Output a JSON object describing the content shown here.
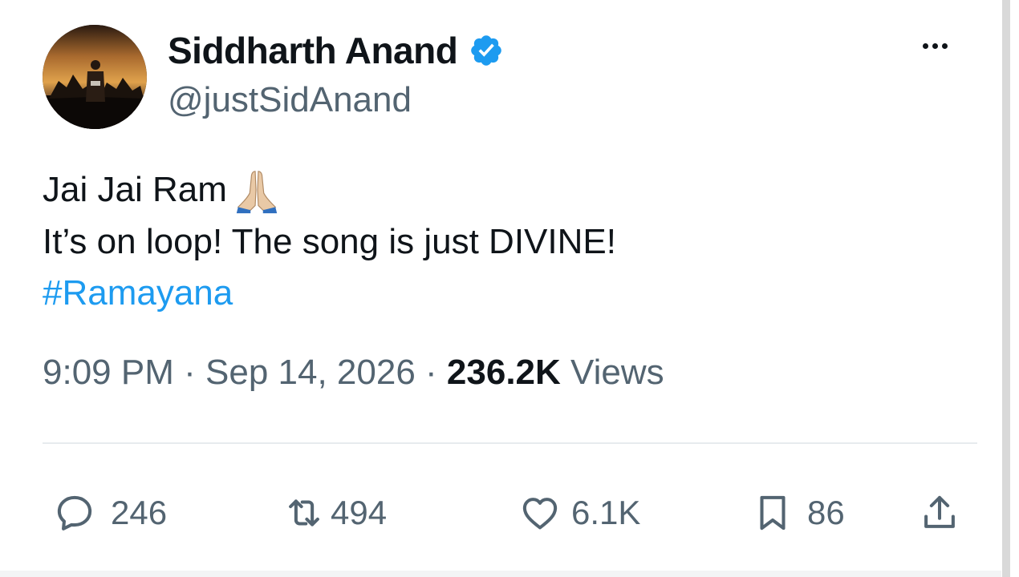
{
  "author": {
    "display_name": "Siddharth Anand",
    "handle": "@justSidAnand",
    "verified": true,
    "avatar_icon": "profile-photo"
  },
  "menu": {
    "icon": "more-icon"
  },
  "tweet": {
    "lines": [
      "Jai Jai Ram",
      "It’s on loop! The song is just DIVINE!"
    ],
    "emoji": "🙏",
    "hashtag": "#Ramayana"
  },
  "meta": {
    "time": "9:09 PM",
    "separator": "·",
    "date": "Sep 14, 2026",
    "views_count": "236.2K",
    "views_label": "Views"
  },
  "actions": {
    "replies": "246",
    "reposts": "494",
    "likes": "6.1K",
    "bookmarks": "86"
  },
  "colors": {
    "text": "#0f1419",
    "secondary": "#536471",
    "link": "#1d9bf0",
    "verified": "#1d9bf0"
  }
}
